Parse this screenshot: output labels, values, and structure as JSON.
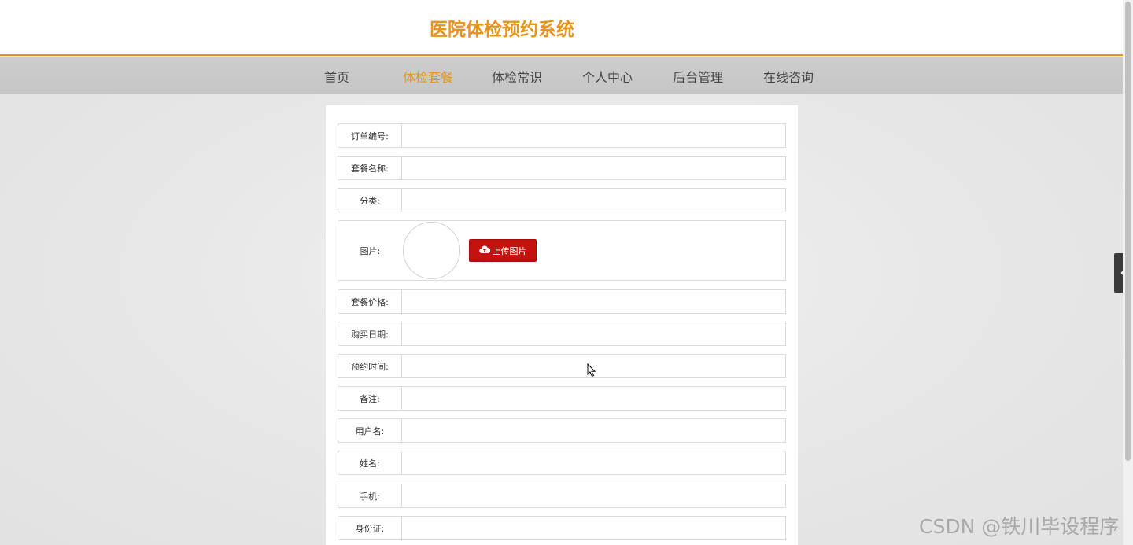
{
  "header": {
    "title": "医院体检预约系统"
  },
  "nav": {
    "items": [
      {
        "label": "首页",
        "active": false
      },
      {
        "label": "体检套餐",
        "active": true
      },
      {
        "label": "体检常识",
        "active": false
      },
      {
        "label": "个人中心",
        "active": false
      },
      {
        "label": "后台管理",
        "active": false
      },
      {
        "label": "在线咨询",
        "active": false
      }
    ]
  },
  "form": {
    "order_no": {
      "label": "订单编号:",
      "value": ""
    },
    "package_name": {
      "label": "套餐名称:",
      "value": ""
    },
    "category": {
      "label": "分类:",
      "value": ""
    },
    "image": {
      "label": "图片:",
      "upload_label": "上传图片",
      "upload_icon": "cloud-upload-icon"
    },
    "price": {
      "label": "套餐价格:",
      "value": ""
    },
    "purchase_date": {
      "label": "购买日期:",
      "value": ""
    },
    "appointment_time": {
      "label": "预约时间:",
      "value": ""
    },
    "remark": {
      "label": "备注:",
      "value": ""
    },
    "username": {
      "label": "用户名:",
      "value": ""
    },
    "name": {
      "label": "姓名:",
      "value": ""
    },
    "phone": {
      "label": "手机:",
      "value": ""
    },
    "id_card": {
      "label": "身份证:",
      "value": ""
    }
  },
  "side_toggle": {
    "icon": "chevron-left-icon"
  },
  "watermark": "CSDN @铁川毕设程序",
  "colors": {
    "accent": "#e8931a",
    "upload_button": "#c4120f",
    "nav_bg": "#c9c9c9"
  }
}
